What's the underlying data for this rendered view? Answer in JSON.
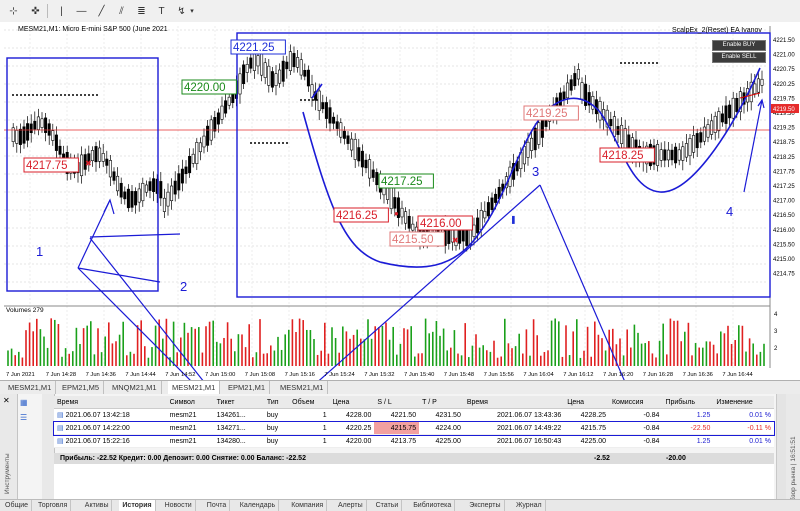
{
  "toolbar": {
    "icons": [
      "crosshair-icon",
      "cursor-icon",
      "vertical-line-icon",
      "horizontal-line-icon",
      "trend-line-icon",
      "channel-icon",
      "fibonacci-icon",
      "text-icon",
      "label-icon",
      "shapes-icon"
    ]
  },
  "chart": {
    "symbol_label": "MESM21,M1:  Micro E-mini S&P 500 (June 2021",
    "ea_label": "ScalpEx_2(Reset) EA  Ivanov",
    "enable_buy": "Enable BUY",
    "enable_sell": "Enable SELL",
    "volume_label": "Volumes 279",
    "price_ticks": [
      "4221.50",
      "4221.00",
      "4220.75",
      "4220.25",
      "4219.75",
      "4219.50",
      "4219.25",
      "4218.75",
      "4218.25",
      "4217.75",
      "4217.25",
      "4217.00",
      "4216.50",
      "4216.00",
      "4215.50",
      "4215.00",
      "4214.75"
    ],
    "current_price": "4219.50",
    "current_price_color": "#e52b2b",
    "vol_ticks": [
      "4",
      "3",
      "2"
    ],
    "time_ticks": [
      "7 Jun 2021",
      "7 Jun 14:28",
      "7 Jun 14:36",
      "7 Jun 14:44",
      "7 Jun 14:52",
      "7 Jun 15:00",
      "7 Jun 15:08",
      "7 Jun 15:16",
      "7 Jun 15:24",
      "7 Jun 15:32",
      "7 Jun 15:40",
      "7 Jun 15:48",
      "7 Jun 15:56",
      "7 Jun 16:04",
      "7 Jun 16:12",
      "7 Jun 16:20",
      "7 Jun 16:28",
      "7 Jun 16:36",
      "7 Jun 16:44"
    ],
    "price_labels": [
      {
        "text": "4221.25",
        "color": "#1f2fd8"
      },
      {
        "text": "4220.00",
        "color": "#1a8a1a"
      },
      {
        "text": "4217.75",
        "color": "#d81f2a"
      },
      {
        "text": "4217.25",
        "color": "#1a8a1a"
      },
      {
        "text": "4216.25",
        "color": "#d81f2a"
      },
      {
        "text": "4216.00",
        "color": "#d81f2a"
      },
      {
        "text": "4215.50",
        "color": "#e07878"
      },
      {
        "text": "4219.25",
        "color": "#e07878"
      },
      {
        "text": "4218.25",
        "color": "#d81f2a"
      }
    ],
    "annotation_numbers": [
      "1",
      "2",
      "3",
      "4"
    ],
    "accent_color": "#1b1bd6"
  },
  "tabs": [
    "MESM21,M1",
    "EPM21,M5",
    "MNQM21,M1",
    "MESM21,M1",
    "EPM21,M1",
    "MESM21,M1"
  ],
  "active_tab": 3,
  "terminal": {
    "columns": [
      "Время",
      "Символ",
      "Тикет",
      "Тип",
      "Объем",
      "Цена",
      "S / L",
      "T / P",
      "Время",
      "Цена",
      "Комиссия",
      "Прибыль",
      "Изменение"
    ],
    "rows": [
      [
        "2021.06.07 13:42:18",
        "mesm21",
        "134261...",
        "buy",
        "1",
        "4228.00",
        "4221.50",
        "4231.50",
        "2021.06.07 13:43:36",
        "4228.25",
        "-0.84",
        "1.25",
        "0.01 %"
      ],
      [
        "2021.06.07 14:22:00",
        "mesm21",
        "134271...",
        "buy",
        "1",
        "4220.25",
        "4215.75",
        "4224.00",
        "2021.06.07 14:49:22",
        "4215.75",
        "-0.84",
        "-22.50",
        "-0.11 %"
      ],
      [
        "2021.06.07 15:22:16",
        "mesm21",
        "134280...",
        "buy",
        "1",
        "4220.00",
        "4213.75",
        "4225.00",
        "2021.06.07 16:50:43",
        "4225.00",
        "-0.84",
        "1.25",
        "0.01 %"
      ]
    ],
    "summary": "Прибыль: -22.52  Кредит: 0.00  Депозит: 0.00  Снятие: 0.00  Баланс: -22.52",
    "summary_commission": "-2.52",
    "summary_profit": "-20.00",
    "side_label_left": "Инструменты",
    "side_label_right": "Обзор рынка | 16:51:51",
    "bottom_tabs": [
      "Общие",
      "Торговля",
      "Активы",
      "История",
      "Новости",
      "Почта",
      "Календарь",
      "Компания",
      "Алерты",
      "Статьи",
      "Библиотека",
      "Эксперты",
      "Журнал"
    ],
    "active_bottom_tab": 3,
    "loss_color": "#e52b2b",
    "profit_color": "#1c1cd0"
  }
}
